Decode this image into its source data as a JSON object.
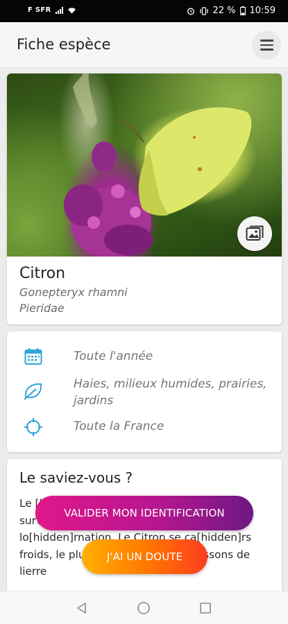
{
  "status": {
    "carrier": "F SFR",
    "battery": "22 %",
    "time": "10:59"
  },
  "appbar": {
    "title": "Fiche espèce",
    "menu_icon": "hamburger-menu-icon"
  },
  "species": {
    "common_name": "Citron",
    "scientific_name": "Gonepteryx rhamni",
    "family": "Pieridae",
    "gallery_icon": "image-gallery-icon"
  },
  "info": {
    "period": {
      "icon": "calendar-icon",
      "text": "Toute l'année"
    },
    "habitat": {
      "icon": "leaf-icon",
      "text": "Haies, milieux humides, prairies, jardins"
    },
    "range": {
      "icon": "crosshair-icon",
      "text": "Toute la France"
    }
  },
  "fact": {
    "title": "Le saviez-vous ?",
    "text": "Le [hidden] redoute [hidden] peut en effet survivre jusqu'à 12 mois, avec une lo[hidden]rnation. Le Citron se ca[hidden]rs froids, le plus souvent dans les buissons de lierre"
  },
  "actions": {
    "validate_label": "VALIDER MON IDENTIFICATION",
    "doubt_label": "J'AI UN DOUTE"
  },
  "colors": {
    "accent_blue": "#2aa6d6",
    "validate_gradient": [
      "#e0178a",
      "#6d1884"
    ],
    "doubt_gradient": [
      "#ffb000",
      "#ff3d1f"
    ]
  }
}
